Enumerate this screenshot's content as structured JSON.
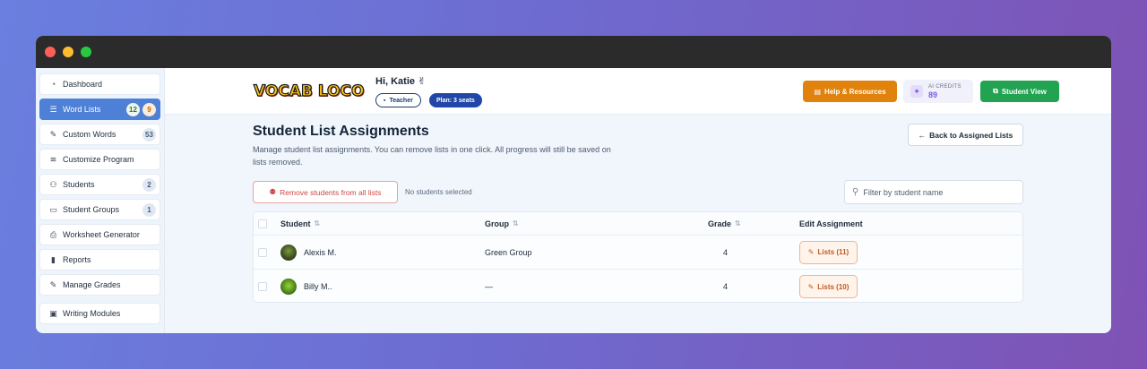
{
  "sidebar": {
    "items": [
      {
        "label": "Dashboard",
        "icon": "gauge-icon",
        "glyph": "◔"
      },
      {
        "label": "Word Lists",
        "icon": "list-icon",
        "glyph": "☰",
        "badges": [
          "12",
          "9"
        ],
        "active": true
      },
      {
        "label": "Custom Words",
        "icon": "edit-icon",
        "glyph": "✎",
        "badges": [
          "53"
        ]
      },
      {
        "label": "Customize Program",
        "icon": "sliders-icon",
        "glyph": "≋"
      },
      {
        "label": "Students",
        "icon": "users-icon",
        "glyph": "⚇",
        "badges": [
          "2"
        ]
      },
      {
        "label": "Student Groups",
        "icon": "folder-icon",
        "glyph": "▭",
        "badges": [
          "1"
        ]
      },
      {
        "label": "Worksheet Generator",
        "icon": "printer-icon",
        "glyph": "⎙"
      },
      {
        "label": "Reports",
        "icon": "bar-chart-icon",
        "glyph": "▮"
      },
      {
        "label": "Manage Grades",
        "icon": "edit-icon",
        "glyph": "✎"
      },
      {
        "label": "Writing Modules",
        "icon": "document-icon",
        "glyph": "▣"
      }
    ]
  },
  "header": {
    "logo": "VOCAB LOCO",
    "greeting": "Hi, Katie ✌",
    "role": "Teacher",
    "plan": "Plan: 3 seats",
    "help_label": "Help & Resources",
    "credits_label": "AI CREDITS",
    "credits_value": "89",
    "student_view_label": "Student View"
  },
  "page": {
    "title": "Student List Assignments",
    "description": "Manage student list assignments. You can remove lists in one click. All progress will still be saved on lists removed.",
    "back_label": "Back to Assigned Lists",
    "remove_label": "Remove students from all lists",
    "selection_status": "No students selected",
    "filter_placeholder": "Filter by student name"
  },
  "table": {
    "columns": {
      "student": "Student",
      "group": "Group",
      "grade": "Grade",
      "edit": "Edit Assignment"
    },
    "rows": [
      {
        "student": "Alexis M.",
        "group": "Green Group",
        "grade": "4",
        "lists": "Lists (11)"
      },
      {
        "student": "Billy M..",
        "group": "—",
        "grade": "4",
        "lists": "Lists (10)"
      }
    ]
  },
  "colors": {
    "accent": "#4d80d6",
    "help": "#e0820c",
    "student_view": "#21a351",
    "plan": "#1f46a8"
  }
}
